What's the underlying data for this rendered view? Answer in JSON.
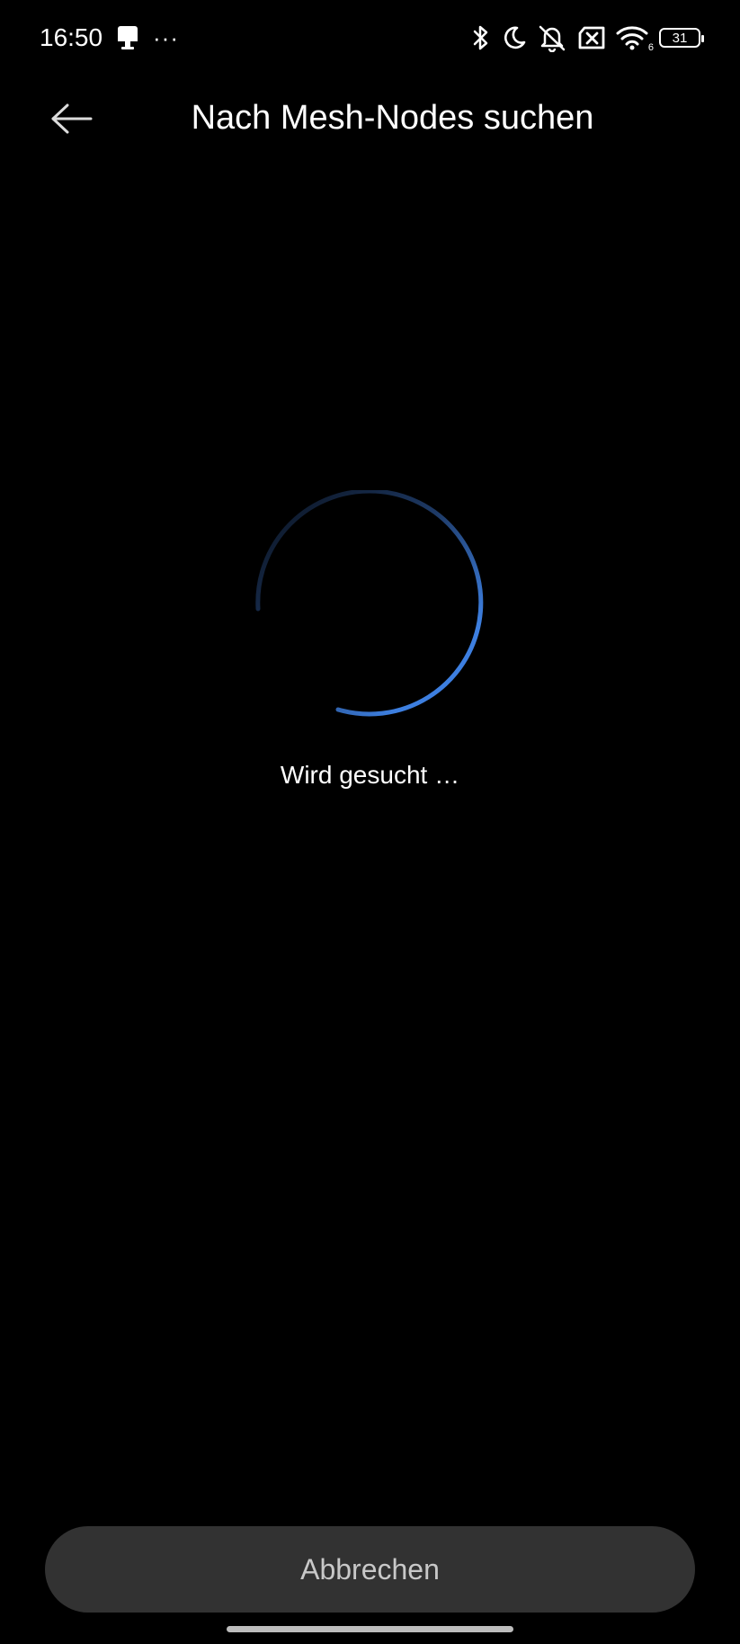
{
  "status_bar": {
    "time": "16:50",
    "overflow": "···",
    "battery_level": "31",
    "left_icons": [
      "notification-icon"
    ],
    "right_icons": [
      "bluetooth-icon",
      "moon-icon",
      "muted-bell-icon",
      "sim-off-icon",
      "wifi-icon",
      "battery-icon"
    ],
    "wifi_label": "6"
  },
  "header": {
    "back_icon": "arrow-left-icon",
    "title": "Nach Mesh-Nodes suchen"
  },
  "main": {
    "spinner_icon": "loading-spinner-icon",
    "status_text": "Wird gesucht …"
  },
  "footer": {
    "cancel_label": "Abbrechen"
  },
  "colors": {
    "background": "#000000",
    "accent": "#3d7fe0",
    "button_bg": "#323232",
    "button_text": "#c8c8c8"
  }
}
